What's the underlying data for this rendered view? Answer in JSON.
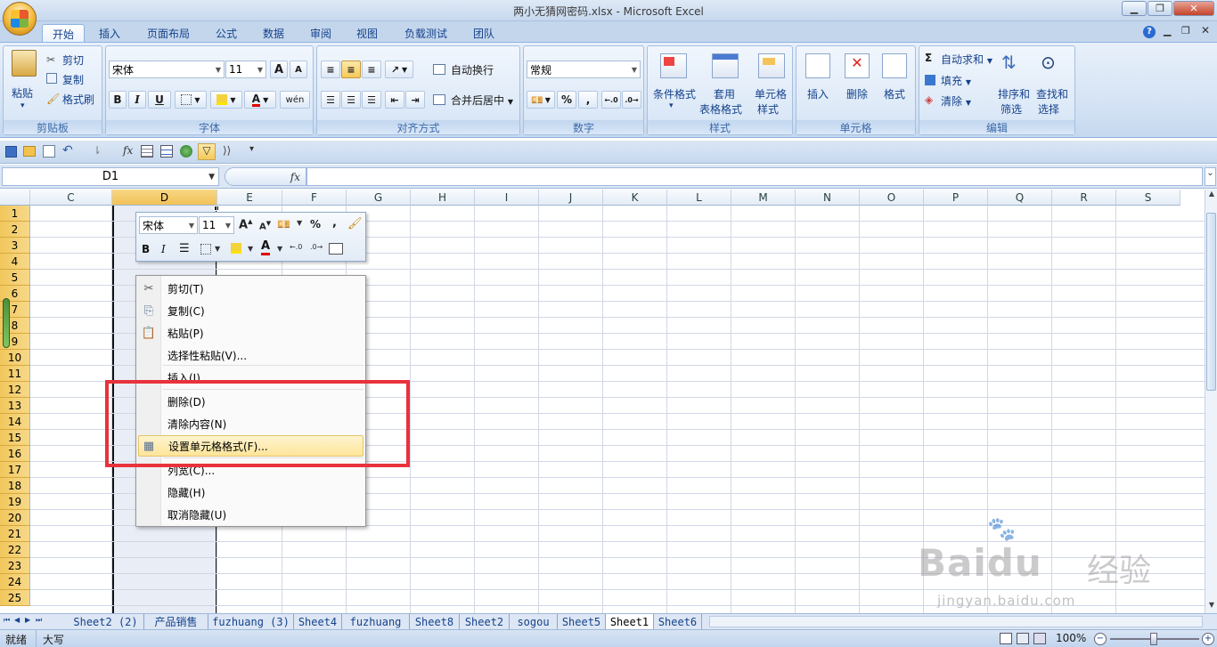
{
  "window": {
    "title": "两小无猜网密码.xlsx - Microsoft Excel",
    "minimize": "▁",
    "restore": "❐",
    "close": "✕"
  },
  "tabs": [
    "开始",
    "插入",
    "页面布局",
    "公式",
    "数据",
    "审阅",
    "视图",
    "负载测试",
    "团队"
  ],
  "ribbon": {
    "clipboard": {
      "label": "剪贴板",
      "paste": "粘贴",
      "cut": "剪切",
      "copy": "复制",
      "format_painter": "格式刷"
    },
    "font": {
      "label": "字体",
      "font_name": "宋体",
      "font_size": "11",
      "bold": "B",
      "italic": "I",
      "underline": "U",
      "grow": "A",
      "shrink": "A",
      "color_a": "A",
      "phonetic": "wén"
    },
    "alignment": {
      "label": "对齐方式",
      "wrap": "自动换行",
      "merge": "合并后居中"
    },
    "number": {
      "label": "数字",
      "format": "常规",
      "percent": "%",
      "comma": ","
    },
    "styles": {
      "label": "样式",
      "conditional": "条件格式",
      "table_format_1": "套用",
      "table_format_2": "表格格式",
      "cell_style_1": "单元格",
      "cell_style_2": "样式"
    },
    "cells": {
      "label": "单元格",
      "insert": "插入",
      "delete": "删除",
      "format": "格式"
    },
    "editing": {
      "label": "编辑",
      "autosum": "自动求和",
      "fill": "填充",
      "clear": "清除",
      "sort_1": "排序和",
      "sort_2": "筛选",
      "find_1": "查找和",
      "find_2": "选择"
    }
  },
  "formula_bar": {
    "name_box": "D1",
    "fx": "fx",
    "value": ""
  },
  "columns": [
    "C",
    "D",
    "E",
    "F",
    "G",
    "H",
    "I",
    "J",
    "K",
    "L",
    "M",
    "N",
    "O",
    "P",
    "Q",
    "R",
    "S"
  ],
  "selected_column": "D",
  "rows": [
    "1",
    "2",
    "3",
    "4",
    "5",
    "6",
    "7",
    "8",
    "9",
    "10",
    "11",
    "12",
    "13",
    "14",
    "15",
    "16",
    "17",
    "18",
    "19",
    "20",
    "21",
    "22",
    "23",
    "24",
    "25"
  ],
  "mini_toolbar": {
    "font_name": "宋体",
    "font_size": "11",
    "percent": "%",
    "comma": ",",
    "bold": "B",
    "italic": "I",
    "color_a": "A"
  },
  "context_menu": [
    {
      "label": "剪切(T)",
      "icon": "scissors-icon"
    },
    {
      "label": "复制(C)",
      "icon": "copy-icon"
    },
    {
      "label": "粘贴(P)",
      "icon": "paste-icon"
    },
    {
      "label": "选择性粘贴(V)...",
      "icon": ""
    },
    {
      "label": "插入(I)",
      "icon": ""
    },
    {
      "label": "删除(D)",
      "icon": ""
    },
    {
      "label": "清除内容(N)",
      "icon": ""
    },
    {
      "label": "设置单元格格式(F)...",
      "icon": "format-cells-icon"
    },
    {
      "label": "列宽(C)...",
      "icon": ""
    },
    {
      "label": "隐藏(H)",
      "icon": ""
    },
    {
      "label": "取消隐藏(U)",
      "icon": ""
    }
  ],
  "sheets": [
    "Sheet2 (2)",
    "产品销售",
    "fuzhuang (3)",
    "Sheet4",
    "fuzhuang",
    "Sheet8",
    "Sheet2",
    "sogou",
    "Sheet5",
    "Sheet1",
    "Sheet6"
  ],
  "active_sheet": "Sheet1",
  "status": {
    "ready": "就绪",
    "caps": "大写",
    "zoom": "100%"
  },
  "watermark": {
    "brand": "Bai",
    "brand_du": "du",
    "cn": "经验",
    "url": "jingyan.baidu.com"
  },
  "colors": {
    "highlight_border": "#e8323c",
    "ribbon_bg": "#d3e2f4",
    "selected_header": "#f1c15a"
  }
}
